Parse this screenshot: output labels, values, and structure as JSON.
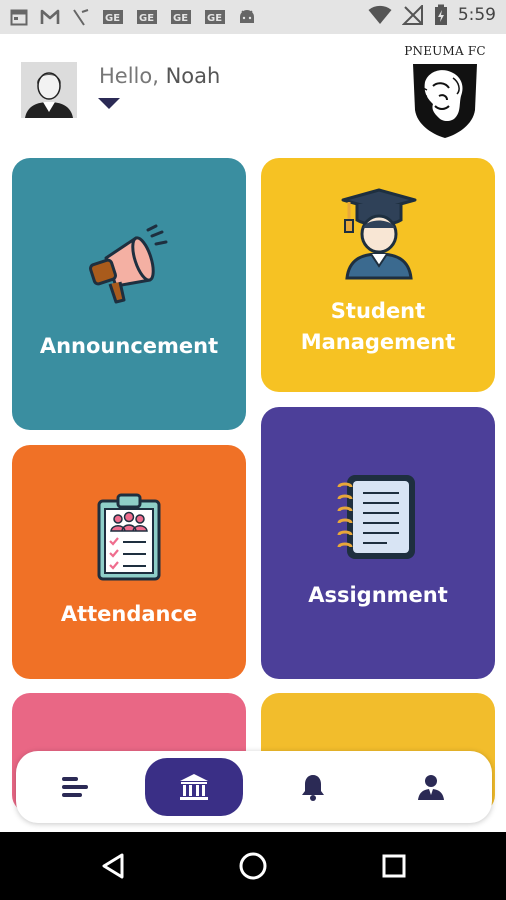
{
  "status_bar": {
    "time": "5:59",
    "left_icons": [
      "calendar-icon",
      "gmail-icon",
      "signal-slash-icon",
      "ge-app-icon",
      "ge-app-icon",
      "ge-app-icon",
      "ge-app-icon",
      "android-icon"
    ],
    "right_icons": [
      "wifi-icon",
      "no-signal-icon",
      "battery-charging-icon"
    ]
  },
  "header": {
    "greeting": "Hello,",
    "user_name": "Noah",
    "brand_name": "PNEUMA FC",
    "brand_logo": "lion-shield-logo"
  },
  "tiles": [
    {
      "label": "Announcement",
      "icon": "megaphone-icon",
      "color": "#3a8ea0"
    },
    {
      "label_line1": "Student",
      "label_line2": "Management",
      "icon": "graduate-icon",
      "color": "#f6c223"
    },
    {
      "label": "Attendance",
      "icon": "clipboard-icon",
      "color": "#f07126"
    },
    {
      "label": "Assignment",
      "icon": "notebook-icon",
      "color": "#4c3f99"
    },
    {
      "label": "",
      "color": "#e96785"
    },
    {
      "label": "",
      "color": "#f2bd2c"
    }
  ],
  "bottom_nav": {
    "items": [
      {
        "icon": "menu-icon",
        "active": false
      },
      {
        "icon": "institution-icon",
        "active": true
      },
      {
        "icon": "bell-icon",
        "active": false
      },
      {
        "icon": "user-icon",
        "active": false
      }
    ],
    "active_color": "#3a2f86"
  },
  "system_nav": {
    "buttons": [
      "back-icon",
      "home-circle-icon",
      "recents-square-icon"
    ]
  }
}
